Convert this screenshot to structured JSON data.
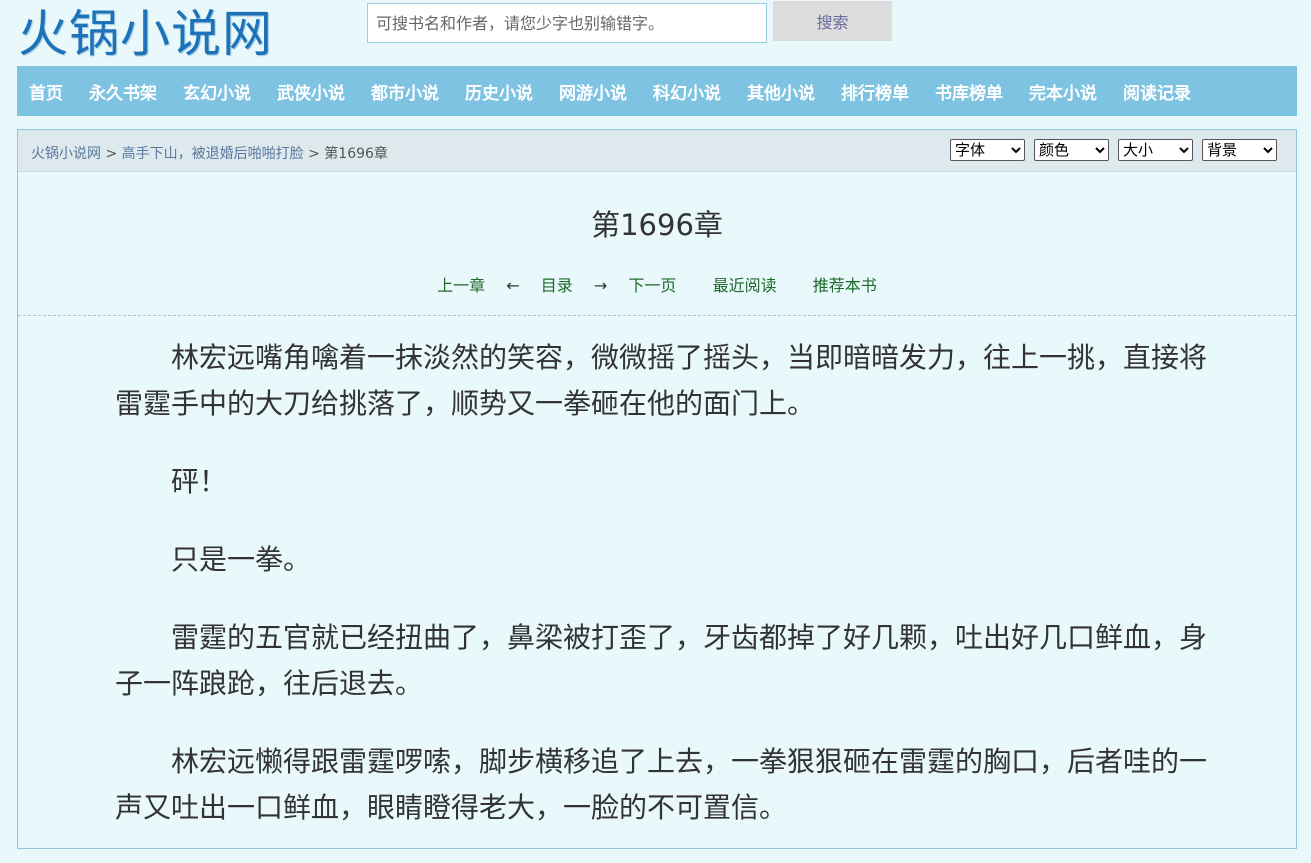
{
  "site": {
    "logo": "火锅小说网"
  },
  "search": {
    "placeholder": "可搜书名和作者，请您少字也别输错字。",
    "button": "搜索"
  },
  "nav": [
    "首页",
    "永久书架",
    "玄幻小说",
    "武侠小说",
    "都市小说",
    "历史小说",
    "网游小说",
    "科幻小说",
    "其他小说",
    "排行榜单",
    "书库榜单",
    "完本小说",
    "阅读记录"
  ],
  "breadcrumb": {
    "home": "火锅小说网",
    "book": "高手下山，被退婚后啪啪打脸",
    "current": "第1696章",
    "separator": ">"
  },
  "selects": {
    "font": "字体",
    "color": "颜色",
    "size": "大小",
    "background": "背景"
  },
  "chapter": {
    "title": "第1696章",
    "prev": "上一章",
    "left_arrow": "←",
    "toc": "目录",
    "right_arrow": "→",
    "next": "下一页",
    "recent": "最近阅读",
    "recommend": "推荐本书"
  },
  "paragraphs": [
    "林宏远嘴角噙着一抹淡然的笑容，微微摇了摇头，当即暗暗发力，往上一挑，直接将雷霆手中的大刀给挑落了，顺势又一拳砸在他的面门上。",
    "砰！",
    "只是一拳。",
    "雷霆的五官就已经扭曲了，鼻梁被打歪了，牙齿都掉了好几颗，吐出好几口鲜血，身子一阵踉跄，往后退去。",
    "林宏远懒得跟雷霆啰嗦，脚步横移追了上去，一拳狠狠砸在雷霆的胸口，后者哇的一声又吐出一口鲜血，眼睛瞪得老大，一脸的不可置信。"
  ]
}
